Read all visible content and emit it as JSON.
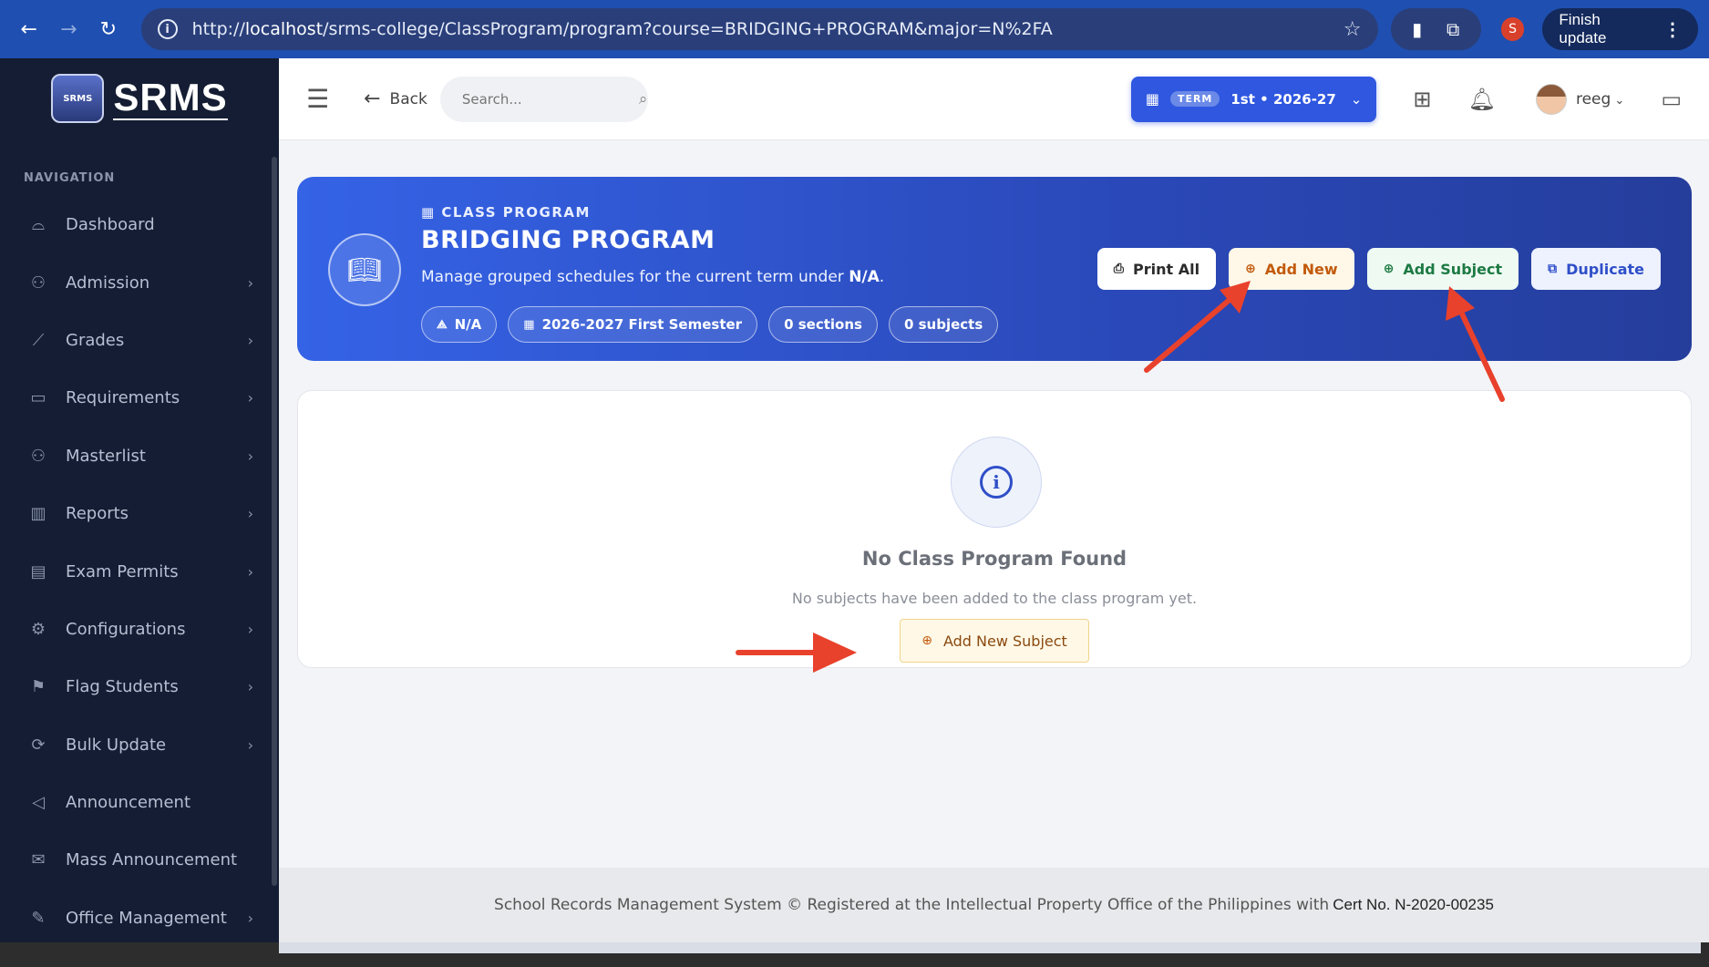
{
  "browser": {
    "url_prefix": "http://",
    "url_host": "localhost",
    "url_path": "/srms-college/ClassProgram/program?course=BRIDGING+PROGRAM&major=N%2FA",
    "profile_initial": "S",
    "finish_update_label": "Finish update"
  },
  "sidebar": {
    "brand": "SRMS",
    "crest_text": "SRMS",
    "heading": "NAVIGATION",
    "items": [
      {
        "label": "Dashboard",
        "icon": "⌓",
        "chev": ""
      },
      {
        "label": "Admission",
        "icon": "⚇",
        "chev": "›"
      },
      {
        "label": "Grades",
        "icon": "⟋",
        "chev": "›"
      },
      {
        "label": "Requirements",
        "icon": "▭",
        "chev": "›"
      },
      {
        "label": "Masterlist",
        "icon": "⚇",
        "chev": "›"
      },
      {
        "label": "Reports",
        "icon": "▥",
        "chev": "›"
      },
      {
        "label": "Exam Permits",
        "icon": "▤",
        "chev": "›"
      },
      {
        "label": "Configurations",
        "icon": "⚙",
        "chev": "›"
      },
      {
        "label": "Flag Students",
        "icon": "⚑",
        "chev": "›"
      },
      {
        "label": "Bulk Update",
        "icon": "⟳",
        "chev": "›"
      },
      {
        "label": "Announcement",
        "icon": "◁",
        "chev": ""
      },
      {
        "label": "Mass Announcement",
        "icon": "✉",
        "chev": ""
      },
      {
        "label": "Office Management",
        "icon": "✎",
        "chev": "›"
      }
    ]
  },
  "topbar": {
    "back_label": "Back",
    "search_placeholder": "Search...",
    "term_tag": "TERM",
    "term_value": "1st • 2026-27",
    "user_name": "reeg"
  },
  "banner": {
    "kicker": "CLASS PROGRAM",
    "title": "BRIDGING PROGRAM",
    "desc_prefix": "Manage grouped schedules for the current term under ",
    "desc_major": "N/A",
    "desc_suffix": ".",
    "chips": {
      "major": "N/A",
      "term": "2026-2027 First Semester",
      "sections": "0 sections",
      "subjects": "0 subjects"
    },
    "actions": {
      "print": "Print All",
      "add_new": "Add New",
      "add_subject": "Add Subject",
      "duplicate": "Duplicate"
    }
  },
  "empty_state": {
    "title": "No Class Program Found",
    "subtitle": "No subjects have been added to the class program yet.",
    "button": "Add New Subject"
  },
  "footer": {
    "text": "School Records Management System © Registered at the Intellectual Property Office of the Philippines with",
    "cert": "Cert No. N-2020-00235"
  },
  "colors": {
    "primary": "#2f57e0",
    "sidebar_bg": "#141d33",
    "annotation_red": "#e8412c"
  }
}
